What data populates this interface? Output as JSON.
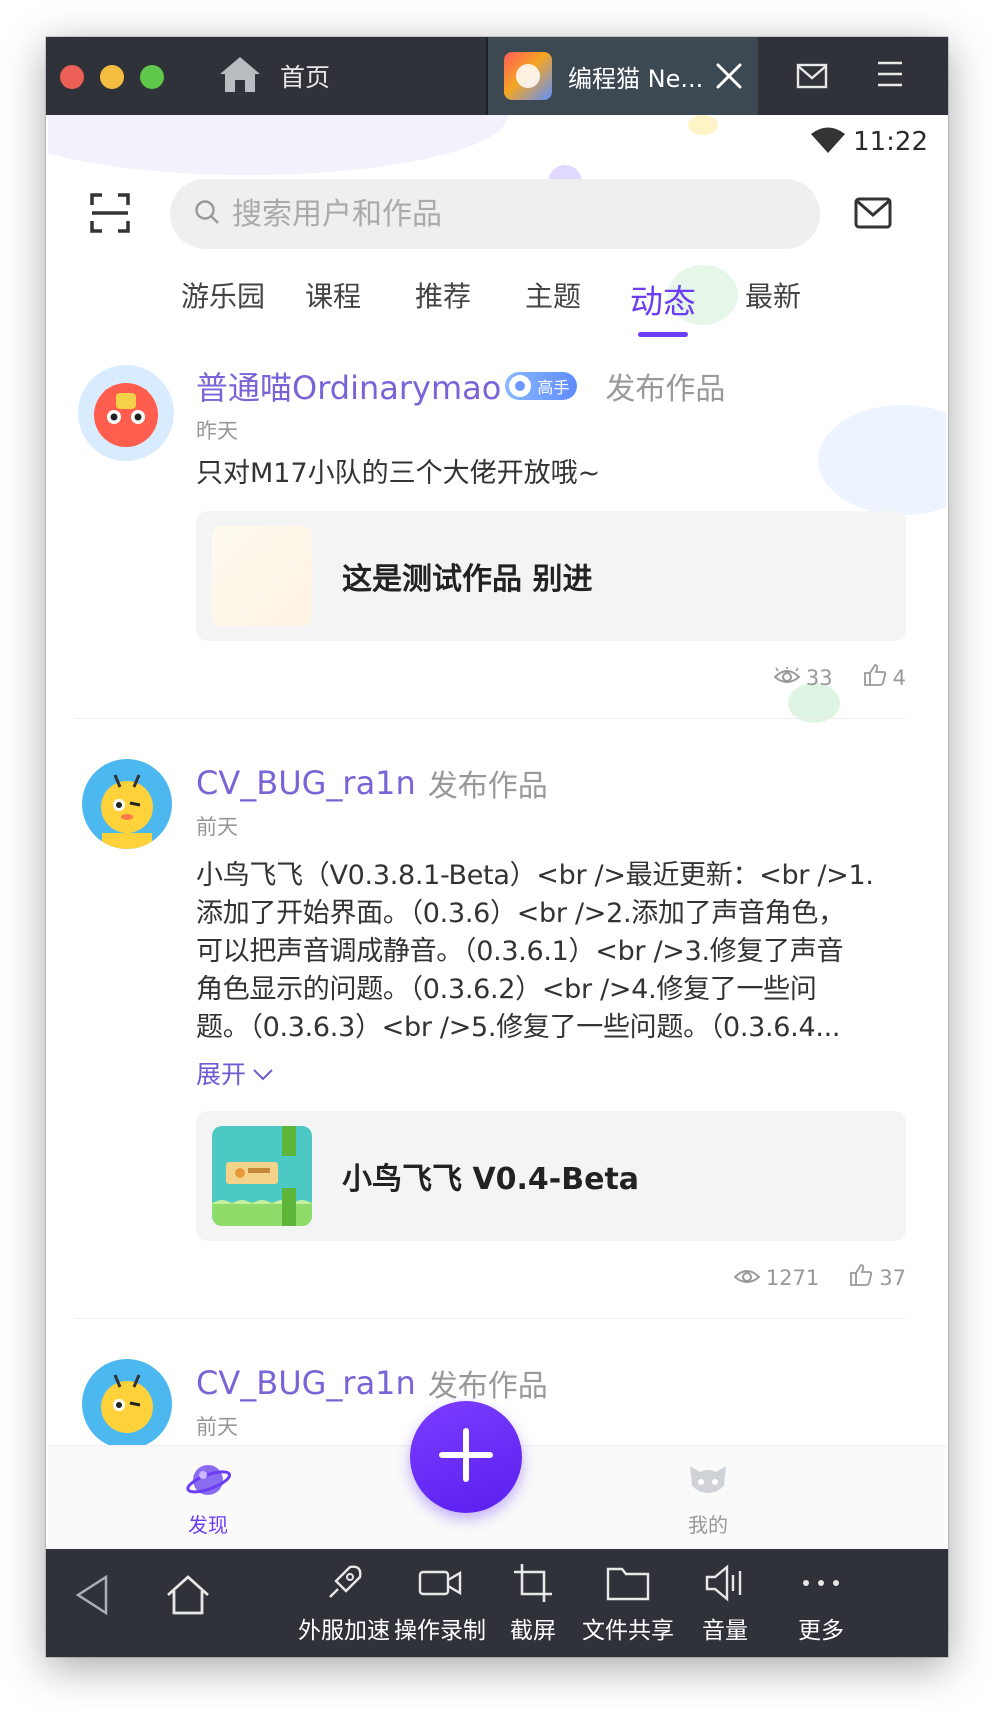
{
  "emulator": {
    "home_tab_label": "首页",
    "active_tab_label": "编程猫 Ne...",
    "toolbar": {
      "items": [
        "外服加速",
        "操作录制",
        "截屏",
        "文件共享",
        "音量",
        "更多"
      ]
    }
  },
  "status_bar": {
    "time": "11:22"
  },
  "search": {
    "placeholder": "搜索用户和作品"
  },
  "tabs": [
    "游乐园",
    "课程",
    "推荐",
    "主题",
    "动态",
    "最新"
  ],
  "active_tab": "动态",
  "posts": [
    {
      "username": "普通喵Ordinarymao",
      "badge": "高手",
      "action": "发布作品",
      "time": "昨天",
      "text": "只对M17小队的三个大佬开放哦~",
      "work_title": "这是测试作品 别进",
      "views": "33",
      "likes": "4"
    },
    {
      "username": "CV_BUG_ra1n",
      "action": "发布作品",
      "time": "前天",
      "text_lines": [
        "小鸟飞飞（V0.3.8.1-Beta）<br />最近更新：<br />1.",
        "添加了开始界面。（0.3.6）<br />2.添加了声音角色，",
        "可以把声音调成静音。（0.3.6.1）<br />3.修复了声音",
        "角色显示的问题。（0.3.6.2）<br />4.修复了一些问",
        "题。（0.3.6.3）<br />5.修复了一些问题。（0.3.6.4..."
      ],
      "expand": "展开",
      "work_title": "小鸟飞飞 V0.4-Beta",
      "views": "1271",
      "likes": "37"
    },
    {
      "username": "CV_BUG_ra1n",
      "action": "发布作品",
      "time": "前天"
    }
  ],
  "bottom_nav": {
    "discover": "发现",
    "mine": "我的"
  },
  "colors": {
    "accent": "#6c3df4",
    "username": "#7a63d6",
    "emulator_bar": "#2f3339"
  }
}
